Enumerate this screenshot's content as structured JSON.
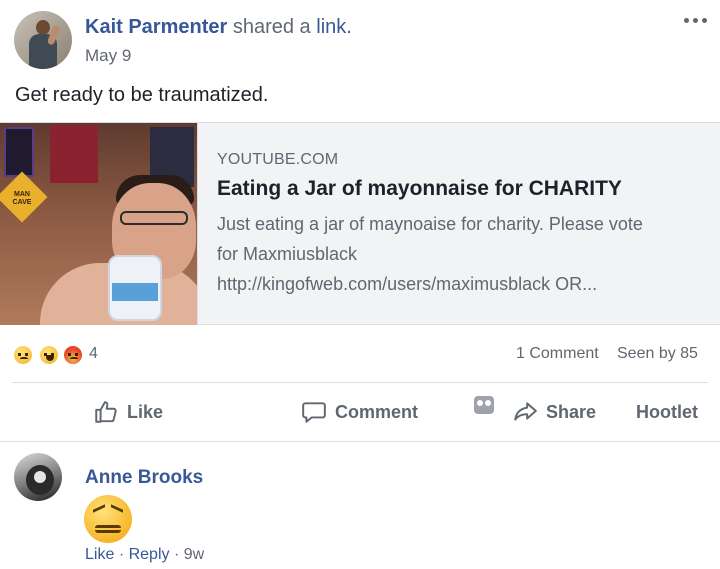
{
  "post": {
    "author_name": "Kait Parmenter",
    "action_text": "shared a",
    "link_word": "link.",
    "date": "May 9",
    "text": "Get ready to be traumatized."
  },
  "link_card": {
    "domain": "YOUTUBE.COM",
    "title": "Eating a Jar of mayonnaise for CHARITY",
    "description_lines": [
      "Just eating a jar of maynoaise for charity. Please vote",
      "for Maxmiusblack",
      "http://kingofweb.com/users/maximusblack OR..."
    ],
    "thumbnail_sign": "MAN CAVE"
  },
  "stats": {
    "reactions": [
      "sad",
      "haha",
      "angry"
    ],
    "reaction_count": "4",
    "comments": "1 Comment",
    "seen_by": "Seen by 85"
  },
  "actions": {
    "like": "Like",
    "comment": "Comment",
    "share": "Share",
    "hootlet": "Hootlet"
  },
  "comment": {
    "author": "Anne Brooks",
    "emoji": "confounded-face",
    "like": "Like",
    "separator": "·",
    "reply": "Reply",
    "time": "9w"
  },
  "colors": {
    "link_blue": "#365899",
    "meta_gray": "#606770",
    "card_bg": "#f2f3f5",
    "divider": "#dadde1"
  }
}
